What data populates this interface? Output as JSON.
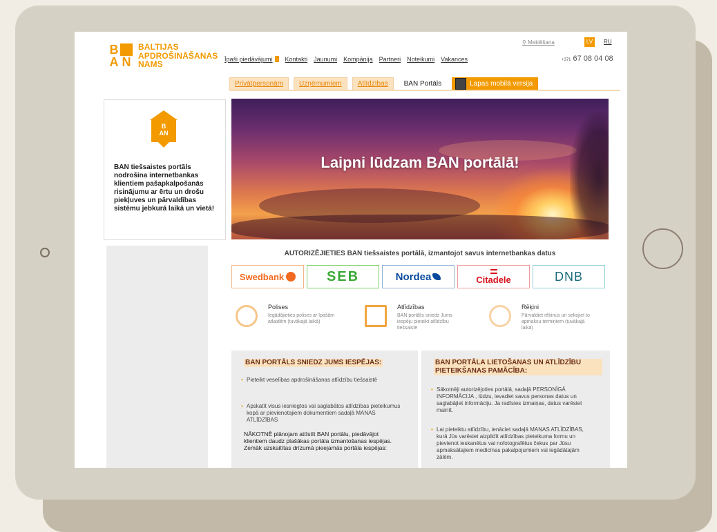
{
  "brand": {
    "logo_letters": [
      "B",
      "A",
      "N"
    ],
    "name_lines": [
      "BALTIJAS",
      "APDROŠINĀŠANAS",
      "NAMS"
    ],
    "color": "#f29a00"
  },
  "header": {
    "search": "Meklēšana",
    "langs": [
      "LV",
      "RU"
    ],
    "phone_prefix": "+371",
    "phone": "67 08 04 08",
    "topnav": [
      "Īpaši piedāvājumi",
      "Kontakti",
      "Jaunumi",
      "Kompānija",
      "Partneri",
      "Noteikumi",
      "Vakances"
    ]
  },
  "tabs": [
    "Privātpersonām",
    "Uzņēmumiem",
    "Atlīdzības",
    "BAN Portāls",
    "Lapas mobilā versija"
  ],
  "promo": {
    "icon": "ban-house-icon",
    "text": "BAN tiešsaistes portāls nodrošina internetbankas klientiem pašapkalpošanās risinājumu ar ērtu un drošu piekļuves un pārvaldības sistēmu jebkurā laikā un vietā!"
  },
  "hero": {
    "title": "Laipni lūdzam BAN portālā!"
  },
  "auth_text": "AUTORIZĒJIETIES BAN tiešsaistes portālā, izmantojot savus internetbankas datus",
  "banks": [
    "Swedbank",
    "SEB",
    "Nordea",
    "Citadele",
    "DNB"
  ],
  "features": [
    {
      "title": "Polises",
      "desc": "Iegādājieties polises ar īpašām atlaidēm (tuvākajā laikā)",
      "icon": "gear-icon"
    },
    {
      "title": "Atlīdzības",
      "desc": "BAN portālis sniedz Jums iespēju pieteikt atlīdzību tiešsaistē",
      "icon": "document-pen-icon"
    },
    {
      "title": "Rēķini",
      "desc": "Pārvaldiet rēķinus un sekojiet to apmaksu termiņiem (tuvākajā laikā)",
      "icon": "clock-icon"
    }
  ],
  "left_panel": {
    "heading": "BAN PORTĀLS SNIEDZ JUMS IESPĒJAS:",
    "items": [
      "Pieteikt veselības apdrošināšanas atlīdzību tiešsaistē",
      "Apskatīt visus iesniegtos vai saglabātos atlīdzības pieteikumus kopā ar pievienotajiem dokumentiem sadaļā MANAS ATLĪDZĪBAS"
    ],
    "paragraph": "NĀKOTNĒ plānojam attīstīt BAN portālu, piedāvājot klientiem daudz plašākas portāla izmantošanas iespējas. Zemāk uzskaitītas drīzumā pieejamās portāla iespējas:"
  },
  "right_panel": {
    "heading": "BAN PORTĀLA LIETOŠANAS UN ATLĪDZĪBU PIETEIKŠANAS PAMĀCĪBA:",
    "items": [
      "Sākotnēji autorizējoties portālā, sadaļā PERSONĪGĀ INFORMĀCIJA , lūdzu, ievadiet savus personas datus un saglabājiet informāciju. Ja radīsies izmaiņas, datus varēsiet mainīt.",
      "Lai pieteiktu atlīdzību, ienāciet sadaļā MANAS ATLĪDZĪBAS, kurā Jūs varēsiet aizpildīt atlīdzības pieteikuma formu un pievienot ieskanētus vai nofotografētus čekus par Jūsu apmaksātajiem medicīnas pakalpojumiem vai iegādātajām zālēm."
    ]
  }
}
